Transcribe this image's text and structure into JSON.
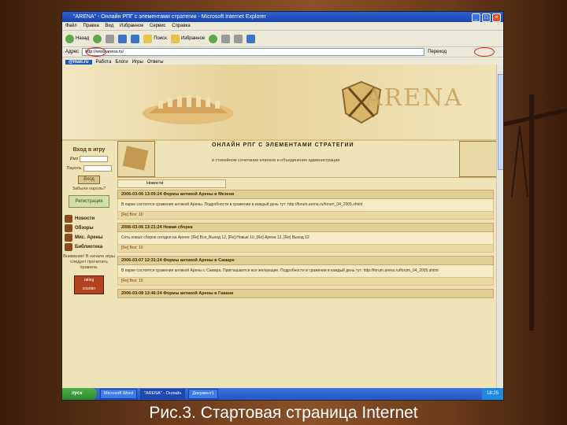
{
  "window": {
    "title": "\"ARENA\" - Онлайн РПГ с элементами стратегии - Microsoft Internet Explorer",
    "menu": [
      "Файл",
      "Правка",
      "Вид",
      "Избранное",
      "Сервис",
      "Справка"
    ]
  },
  "toolbar": {
    "back_label": "Назад",
    "search_label": "Поиск",
    "favorites_label": "Избранное"
  },
  "address": {
    "label": "Адрес",
    "value": "http://www.arena.ru/",
    "go_label": "Переход"
  },
  "linkbar": {
    "mailru": "@mail.ru",
    "items": [
      "Работа",
      "Блоги",
      "Игры",
      "Ответы"
    ]
  },
  "site": {
    "logo": "ARENA",
    "header_title": "ОНЛАЙН РПГ С ЭЛЕМЕНТАМИ СТРАТЕГИИ",
    "header_sub": "в стихийном сочетании клинков и объединения администрации",
    "news_tab": "Новости"
  },
  "login": {
    "title": "Вход в игру",
    "name_label": "Имя",
    "password_label": "Пароль",
    "button": "Вход",
    "forgot_note": "Забыли пароль?",
    "register_button": "Регистрация"
  },
  "nav": [
    {
      "label": "Новости"
    },
    {
      "label": "Обзоры"
    },
    {
      "label": "Мис. Арены"
    },
    {
      "label": "Библиотека"
    }
  ],
  "left_note": "Внимание! В начале игры следует прочитать правила.",
  "posts": [
    {
      "head": "2006-03-06 13:09:24 Формы антикой Арены в Мезени",
      "body": "В парке состоятся сражения антикой Арены. Подробности в сражении в каждый день тут: http://forum.arena.ru/forum_04_2005.shtml",
      "foot": "[Re] Все: 10"
    },
    {
      "head": "2006-03-06 13:21:24 Новая сборка",
      "body": "Сеть новых сборок сегодня на Арене: [Re] Все_Выход 12, [Re] Новые 10, [Re] Арена 12, [Re] Выход 12",
      "foot": "[Re] Все: 10"
    },
    {
      "head": "2006-03-07 12:31:24 Формы антикой Арены в Самаре",
      "body": "В парке состоятся сражения антикой Арены с Самара. Приглашаются все желающие. Подробности в сражении в каждый день тут: http://forum.arena.ru/forum_04_2005.shtml",
      "foot": "[Re] Все: 10"
    },
    {
      "head": "2006-03-08 13:46:24 Формы антикой Арены в Гавани",
      "body": "",
      "foot": ""
    }
  ],
  "taskbar": {
    "start": "пуск",
    "tasks": [
      "Microsoft Word",
      "\"ARENA\" - Онлайн",
      "Документ1"
    ],
    "tray_time": "18:25"
  },
  "caption": "Рис.3. Стартовая страница Internet"
}
